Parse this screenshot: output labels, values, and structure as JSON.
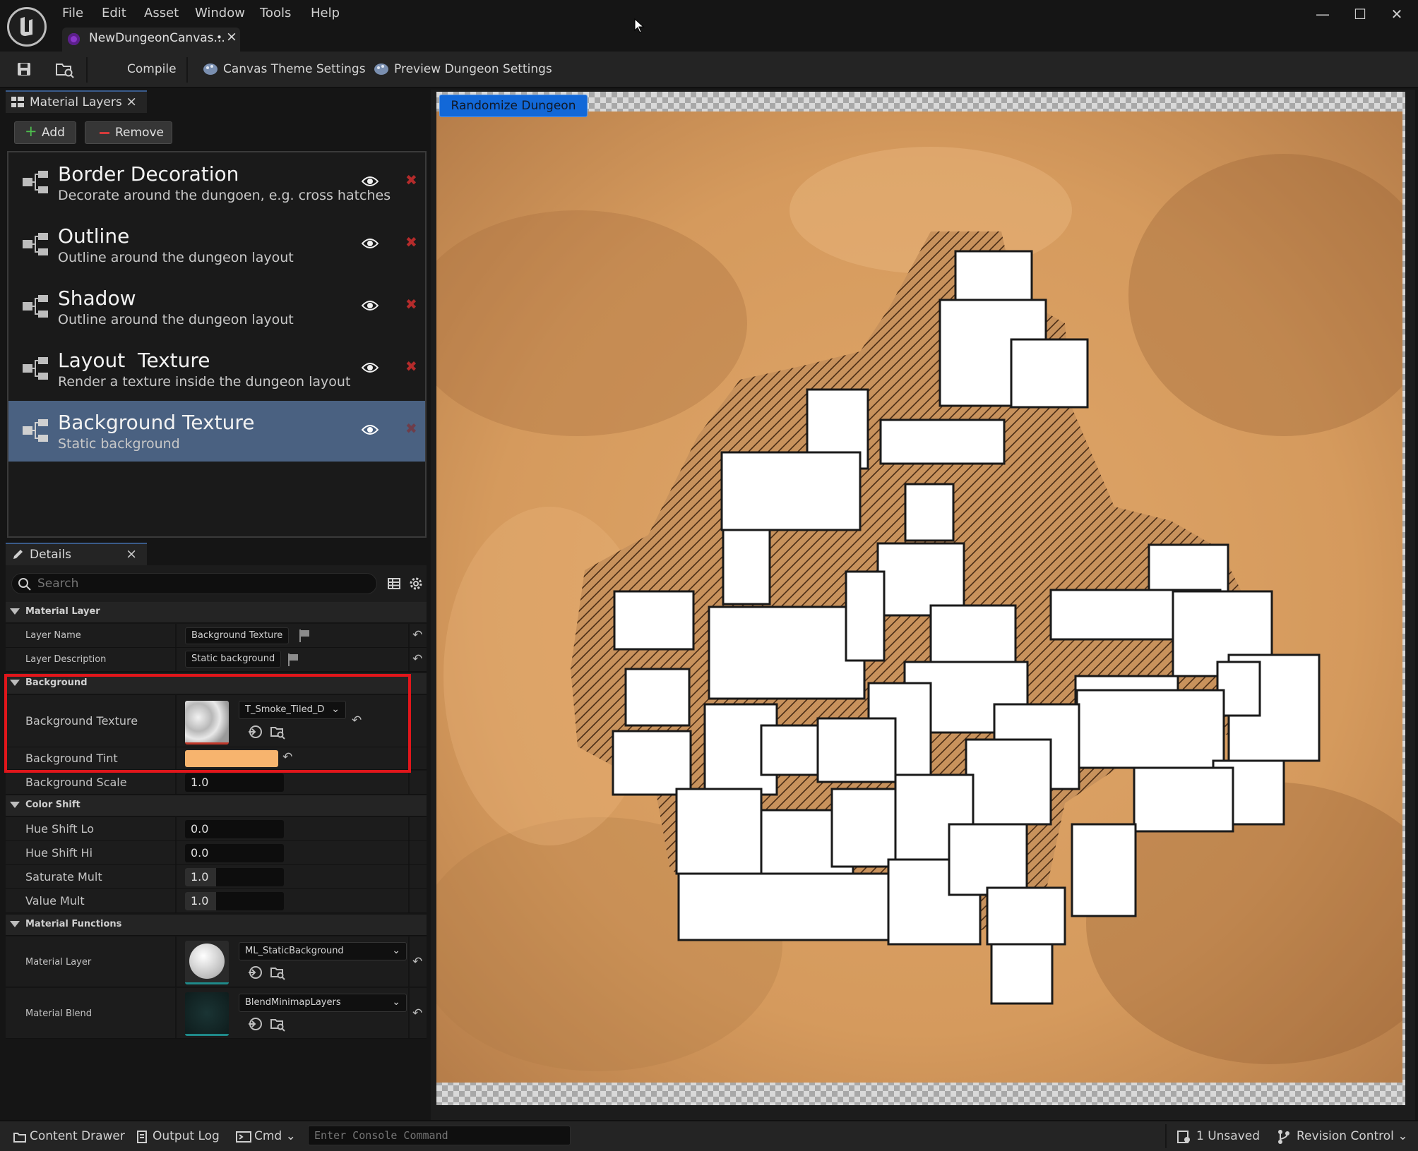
{
  "menu": [
    "File",
    "Edit",
    "Asset",
    "Window",
    "Tools",
    "Help"
  ],
  "document_tab": {
    "name": "NewDungeonCanvas...",
    "modified_marker": "•",
    "close": "×"
  },
  "window_controls": {
    "minimize": "—",
    "maximize": "☐",
    "close": "✕"
  },
  "toolbar": {
    "save_icon": "save-icon",
    "browse_icon": "browse-icon",
    "compile_label": "Compile",
    "canvas_theme_label": "Canvas Theme Settings",
    "preview_dungeon_label": "Preview Dungeon Settings"
  },
  "material_layers_panel": {
    "tab_label": "Material Layers",
    "close": "×",
    "add_label": "Add",
    "remove_label": "Remove",
    "layers": [
      {
        "title": "Border Decoration",
        "description": "Decorate around the dungoen, e.g. cross hatches",
        "selected": false
      },
      {
        "title": "Outline",
        "description": "Outline around the dungeon layout",
        "selected": false
      },
      {
        "title": "Shadow",
        "description": "Outline around the dungeon layout",
        "selected": false
      },
      {
        "title": "Layout  Texture",
        "description": "Render a texture inside the dungeon layout",
        "selected": false
      },
      {
        "title": "Background Texture",
        "description": "Static background",
        "selected": true
      }
    ]
  },
  "details_panel": {
    "tab_label": "Details",
    "close": "×",
    "search_placeholder": "Search",
    "sections": {
      "material_layer": {
        "label": "Material Layer",
        "layer_name_label": "Layer Name",
        "layer_name_value": "Background Texture",
        "layer_description_label": "Layer Description",
        "layer_description_value": "Static background"
      },
      "background": {
        "label": "Background",
        "texture_label": "Background Texture",
        "texture_value": "T_Smoke_Tiled_D",
        "tint_label": "Background Tint",
        "tint_color": "#F7B46E",
        "scale_label": "Background Scale",
        "scale_value": "1.0"
      },
      "color_shift": {
        "label": "Color Shift",
        "hue_lo_label": "Hue Shift Lo",
        "hue_lo_value": "0.0",
        "hue_hi_label": "Hue Shift Hi",
        "hue_hi_value": "0.0",
        "saturate_label": "Saturate Mult",
        "saturate_value": "1.0",
        "value_label": "Value Mult",
        "value_value": "1.0"
      },
      "material_functions": {
        "label": "Material Functions",
        "layer_label": "Material Layer",
        "layer_value": "ML_StaticBackground",
        "blend_label": "Material Blend",
        "blend_value": "BlendMinimapLayers"
      }
    }
  },
  "viewport": {
    "randomize_label": "Randomize Dungeon"
  },
  "statusbar": {
    "content_drawer": "Content Drawer",
    "output_log": "Output Log",
    "cmd": "Cmd",
    "console_placeholder": "Enter Console Command",
    "unsaved": "1 Unsaved",
    "revision_control": "Revision Control"
  },
  "colors": {
    "accent": "#1268D8",
    "highlight": "#E0161B",
    "selection": "#4A6181",
    "delete": "#B42B2B"
  }
}
